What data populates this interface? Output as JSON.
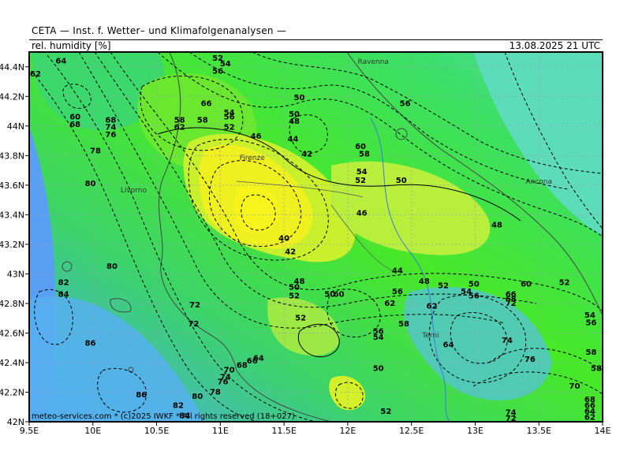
{
  "header": {
    "title": "CETA — Inst. f. Wetter– und Klimafolgenanalysen —",
    "parameter": "rel. humidity [%]",
    "valid_time": "13.08.2025 21 UTC"
  },
  "footer": {
    "credit": "meteo-services.com * (c)2025 IWKF * All rights reserved (18+027)"
  },
  "colors": {
    "dry": "#f4f21e",
    "mid": "#2ee02e",
    "wet": "#4aa8f0",
    "frame": "#000000"
  },
  "map": {
    "lon_range": [
      9.5,
      14.0
    ],
    "lat_range": [
      42.0,
      44.5
    ],
    "x_ticks": [
      {
        "lon": 9.5,
        "label": "9.5E"
      },
      {
        "lon": 10.0,
        "label": "10E"
      },
      {
        "lon": 10.5,
        "label": "10.5E"
      },
      {
        "lon": 11.0,
        "label": "11E"
      },
      {
        "lon": 11.5,
        "label": "11.5E"
      },
      {
        "lon": 12.0,
        "label": "12E"
      },
      {
        "lon": 12.5,
        "label": "12.5E"
      },
      {
        "lon": 13.0,
        "label": "13E"
      },
      {
        "lon": 13.5,
        "label": "13.5E"
      },
      {
        "lon": 14.0,
        "label": "14E"
      }
    ],
    "y_ticks": [
      {
        "lat": 44.4,
        "label": "44.4N"
      },
      {
        "lat": 44.2,
        "label": "44.2N"
      },
      {
        "lat": 44.0,
        "label": "44N"
      },
      {
        "lat": 43.8,
        "label": "43.8N"
      },
      {
        "lat": 43.6,
        "label": "43.6N"
      },
      {
        "lat": 43.4,
        "label": "43.4N"
      },
      {
        "lat": 43.2,
        "label": "43.2N"
      },
      {
        "lat": 43.0,
        "label": "43N"
      },
      {
        "lat": 42.8,
        "label": "42.8N"
      },
      {
        "lat": 42.6,
        "label": "42.6N"
      },
      {
        "lat": 42.4,
        "label": "42.4N"
      },
      {
        "lat": 42.2,
        "label": "42.2N"
      },
      {
        "lat": 42.0,
        "label": "42N"
      }
    ],
    "cities": [
      {
        "name": "Ravenna",
        "lon": 12.2,
        "lat": 44.42
      },
      {
        "name": "Firenze",
        "lon": 11.25,
        "lat": 43.77
      },
      {
        "name": "Livorno",
        "lon": 10.32,
        "lat": 43.55
      },
      {
        "name": "Ancona",
        "lon": 13.5,
        "lat": 43.61
      },
      {
        "name": "Terni",
        "lon": 12.65,
        "lat": 42.57
      }
    ],
    "contour_labels": [
      {
        "v": "64",
        "lon": 9.75,
        "lat": 44.44
      },
      {
        "v": "62",
        "lon": 9.53,
        "lat": 44.35
      },
      {
        "v": "52",
        "lon": 10.98,
        "lat": 44.46
      },
      {
        "v": "54",
        "lon": 11.04,
        "lat": 44.42
      },
      {
        "v": "56",
        "lon": 10.98,
        "lat": 44.37
      },
      {
        "v": "66",
        "lon": 10.89,
        "lat": 44.15
      },
      {
        "v": "58",
        "lon": 10.86,
        "lat": 44.04
      },
      {
        "v": "54",
        "lon": 11.07,
        "lat": 44.09
      },
      {
        "v": "56",
        "lon": 11.07,
        "lat": 44.06
      },
      {
        "v": "52",
        "lon": 11.07,
        "lat": 43.99
      },
      {
        "v": "58",
        "lon": 10.68,
        "lat": 44.04
      },
      {
        "v": "62",
        "lon": 10.68,
        "lat": 43.99
      },
      {
        "v": "68",
        "lon": 10.14,
        "lat": 44.04
      },
      {
        "v": "74",
        "lon": 10.14,
        "lat": 43.99
      },
      {
        "v": "76",
        "lon": 10.14,
        "lat": 43.94
      },
      {
        "v": "60",
        "lon": 9.86,
        "lat": 44.06
      },
      {
        "v": "68",
        "lon": 9.86,
        "lat": 44.01
      },
      {
        "v": "78",
        "lon": 10.02,
        "lat": 43.83
      },
      {
        "v": "80",
        "lon": 9.98,
        "lat": 43.61
      },
      {
        "v": "50",
        "lon": 11.62,
        "lat": 44.19
      },
      {
        "v": "50",
        "lon": 11.58,
        "lat": 44.08
      },
      {
        "v": "48",
        "lon": 11.58,
        "lat": 44.03
      },
      {
        "v": "46",
        "lon": 11.28,
        "lat": 43.93
      },
      {
        "v": "44",
        "lon": 11.57,
        "lat": 43.91
      },
      {
        "v": "42",
        "lon": 11.68,
        "lat": 43.81
      },
      {
        "v": "56",
        "lon": 12.45,
        "lat": 44.15
      },
      {
        "v": "60",
        "lon": 12.1,
        "lat": 43.86
      },
      {
        "v": "58",
        "lon": 12.13,
        "lat": 43.81
      },
      {
        "v": "54",
        "lon": 12.11,
        "lat": 43.69
      },
      {
        "v": "52",
        "lon": 12.1,
        "lat": 43.63
      },
      {
        "v": "50",
        "lon": 12.42,
        "lat": 43.63
      },
      {
        "v": "46",
        "lon": 12.11,
        "lat": 43.41
      },
      {
        "v": "48",
        "lon": 13.17,
        "lat": 43.33
      },
      {
        "v": "40",
        "lon": 11.5,
        "lat": 43.24
      },
      {
        "v": "42",
        "lon": 11.55,
        "lat": 43.15
      },
      {
        "v": "48",
        "lon": 11.62,
        "lat": 42.95
      },
      {
        "v": "50",
        "lon": 11.58,
        "lat": 42.91
      },
      {
        "v": "52",
        "lon": 11.58,
        "lat": 42.85
      },
      {
        "v": "44",
        "lon": 12.39,
        "lat": 43.02
      },
      {
        "v": "48",
        "lon": 12.6,
        "lat": 42.95
      },
      {
        "v": "52",
        "lon": 12.75,
        "lat": 42.92
      },
      {
        "v": "50",
        "lon": 12.99,
        "lat": 42.93
      },
      {
        "v": "54",
        "lon": 12.93,
        "lat": 42.88
      },
      {
        "v": "56",
        "lon": 12.99,
        "lat": 42.85
      },
      {
        "v": "60",
        "lon": 13.4,
        "lat": 42.93
      },
      {
        "v": "66",
        "lon": 13.28,
        "lat": 42.86
      },
      {
        "v": "68",
        "lon": 13.28,
        "lat": 42.83
      },
      {
        "v": "72",
        "lon": 13.28,
        "lat": 42.8
      },
      {
        "v": "52",
        "lon": 13.7,
        "lat": 42.94
      },
      {
        "v": "50",
        "lon": 11.86,
        "lat": 42.86
      },
      {
        "v": "56",
        "lon": 12.39,
        "lat": 42.88
      },
      {
        "v": "52",
        "lon": 11.63,
        "lat": 42.7
      },
      {
        "v": "60",
        "lon": 11.93,
        "lat": 42.86
      },
      {
        "v": "62",
        "lon": 12.33,
        "lat": 42.8
      },
      {
        "v": "62",
        "lon": 12.66,
        "lat": 42.78
      },
      {
        "v": "58",
        "lon": 12.44,
        "lat": 42.66
      },
      {
        "v": "64",
        "lon": 12.79,
        "lat": 42.52
      },
      {
        "v": "56",
        "lon": 12.24,
        "lat": 42.61
      },
      {
        "v": "54",
        "lon": 12.24,
        "lat": 42.57
      },
      {
        "v": "50",
        "lon": 12.24,
        "lat": 42.36
      },
      {
        "v": "54",
        "lon": 13.9,
        "lat": 42.72
      },
      {
        "v": "56",
        "lon": 13.91,
        "lat": 42.67
      },
      {
        "v": "58",
        "lon": 13.91,
        "lat": 42.47
      },
      {
        "v": "58",
        "lon": 14.06,
        "lat": 42.36
      },
      {
        "v": "74",
        "lon": 13.25,
        "lat": 42.55
      },
      {
        "v": "76",
        "lon": 13.43,
        "lat": 42.42
      },
      {
        "v": "70",
        "lon": 13.78,
        "lat": 42.24
      },
      {
        "v": "74",
        "lon": 13.28,
        "lat": 42.06
      },
      {
        "v": "72",
        "lon": 13.28,
        "lat": 42.01
      },
      {
        "v": "68",
        "lon": 13.9,
        "lat": 42.15
      },
      {
        "v": "66",
        "lon": 13.9,
        "lat": 42.11
      },
      {
        "v": "64",
        "lon": 13.9,
        "lat": 42.07
      },
      {
        "v": "62",
        "lon": 13.9,
        "lat": 42.03
      },
      {
        "v": "82",
        "lon": 9.77,
        "lat": 42.94
      },
      {
        "v": "84",
        "lon": 9.77,
        "lat": 42.86
      },
      {
        "v": "80",
        "lon": 10.15,
        "lat": 43.05
      },
      {
        "v": "72",
        "lon": 10.8,
        "lat": 42.79
      },
      {
        "v": "72",
        "lon": 10.79,
        "lat": 42.66
      },
      {
        "v": "86",
        "lon": 9.98,
        "lat": 42.53
      },
      {
        "v": "86",
        "lon": 10.38,
        "lat": 42.18
      },
      {
        "v": "64",
        "lon": 11.3,
        "lat": 42.43
      },
      {
        "v": "66",
        "lon": 11.25,
        "lat": 42.41
      },
      {
        "v": "68",
        "lon": 11.17,
        "lat": 42.38
      },
      {
        "v": "70",
        "lon": 11.07,
        "lat": 42.35
      },
      {
        "v": "74",
        "lon": 11.04,
        "lat": 42.3
      },
      {
        "v": "76",
        "lon": 11.02,
        "lat": 42.27
      },
      {
        "v": "78",
        "lon": 10.96,
        "lat": 42.2
      },
      {
        "v": "80",
        "lon": 10.82,
        "lat": 42.17
      },
      {
        "v": "82",
        "lon": 10.67,
        "lat": 42.11
      },
      {
        "v": "84",
        "lon": 10.72,
        "lat": 42.04
      },
      {
        "v": "52",
        "lon": 12.3,
        "lat": 42.07
      }
    ]
  }
}
